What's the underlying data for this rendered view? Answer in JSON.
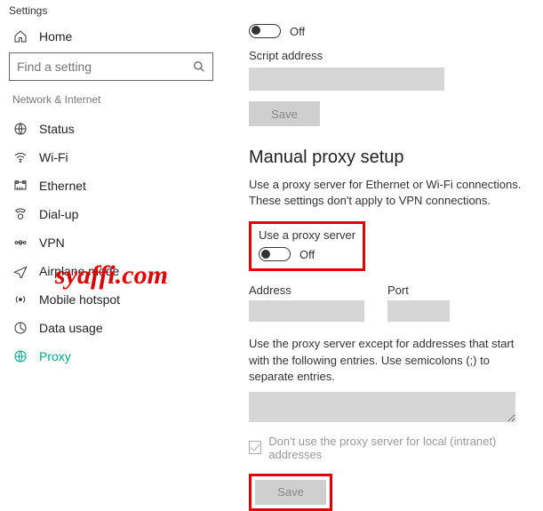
{
  "app": {
    "title": "Settings"
  },
  "sidebar": {
    "home": "Home",
    "search_placeholder": "Find a setting",
    "section": "Network & Internet",
    "items": [
      {
        "label": "Status"
      },
      {
        "label": "Wi-Fi"
      },
      {
        "label": "Ethernet"
      },
      {
        "label": "Dial-up"
      },
      {
        "label": "VPN"
      },
      {
        "label": "Airplane mode"
      },
      {
        "label": "Mobile hotspot"
      },
      {
        "label": "Data usage"
      },
      {
        "label": "Proxy"
      }
    ]
  },
  "auto": {
    "toggle_state": "Off",
    "script_label": "Script address",
    "save": "Save"
  },
  "manual": {
    "heading": "Manual proxy setup",
    "desc": "Use a proxy server for Ethernet or Wi-Fi connections. These settings don't apply to VPN connections.",
    "use_label": "Use a proxy server",
    "toggle_state": "Off",
    "address_label": "Address",
    "port_label": "Port",
    "except_text": "Use the proxy server except for addresses that start with the following entries. Use semicolons (;) to separate entries.",
    "local_label": "Don't use the proxy server for local (intranet) addresses",
    "save": "Save"
  },
  "watermark": "syaffi.com"
}
